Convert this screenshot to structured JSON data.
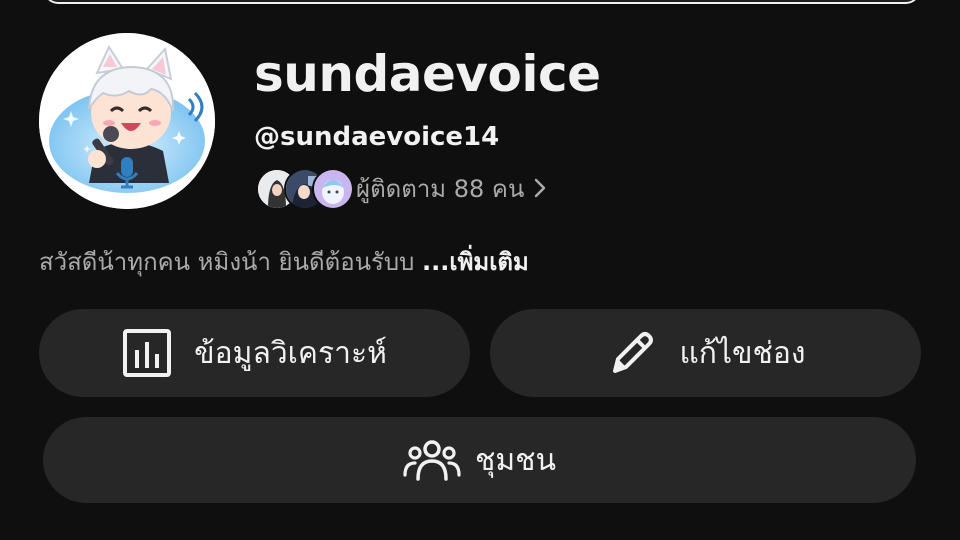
{
  "channel": {
    "name": "sundaevoice",
    "handle": "@sundaevoice14",
    "followers_text": "ผู้ติดตาม 88 คน",
    "avatar_icon": "chibi-cat-ear-singer-avatar"
  },
  "description": {
    "text": "สวัสดีน้าทุกคน หมิงน้า ยินดีต้อนรับบ ",
    "more_label": "...เพิ่มเติม"
  },
  "actions": {
    "analytics_label": "ข้อมูลวิเคราะห์",
    "edit_label": "แก้ไขช่อง",
    "community_label": "ชุมชน"
  },
  "colors": {
    "background": "#0f0f0f",
    "button_bg": "#272727",
    "text_primary": "#f1f1f1",
    "text_secondary": "#aaaaaa"
  }
}
